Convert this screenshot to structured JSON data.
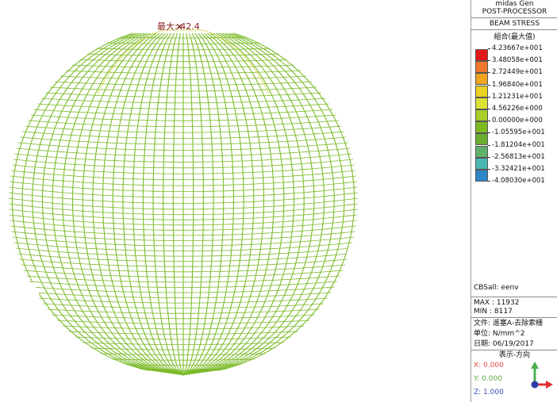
{
  "header": {
    "app_name": "midas Gen",
    "mode": "POST-PROCESSOR",
    "result_type": "BEAM STRESS",
    "component": "組合(最大值)"
  },
  "legend": {
    "levels": [
      "4.23667e+001",
      "3.48058e+001",
      "2.72449e+001",
      "1.96840e+001",
      "1.21231e+001",
      "4.56226e+000",
      "0.00000e+000",
      "-1.05595e+001",
      "-1.81204e+001",
      "-2.56813e+001",
      "-3.32421e+001",
      "-4.08030e+001"
    ],
    "colors": [
      "#e01818",
      "#f0782a",
      "#f0a41c",
      "#ead020",
      "#dde032",
      "#a9cd2a",
      "#7cba1f",
      "#6aae2f",
      "#5fb06a",
      "#4ab7b2",
      "#2d86c7"
    ]
  },
  "load_case": "CBSall: eenv",
  "stats": {
    "max": "MAX : 11932",
    "min": "MIN : 8117"
  },
  "file_info": {
    "file": "文件: 遥塞A-去除索栅",
    "unit": "单位: N/mm^2",
    "date": "日期: 06/19/2017"
  },
  "view_direction": {
    "title": "表示-方向",
    "x": "X: 0.000",
    "y": "Y: 0.000",
    "z": "Z: 1.000",
    "x_color": "#e04b4b",
    "y_color": "#5ca83b",
    "z_color": "#3a4bb8"
  },
  "max_marker": {
    "label": "最大: 42.4",
    "symbol": "✕"
  },
  "model": {
    "type": "spherical dome beam mesh",
    "beam_color": "#7cbb2a",
    "rim_color": "#d8d24a"
  }
}
